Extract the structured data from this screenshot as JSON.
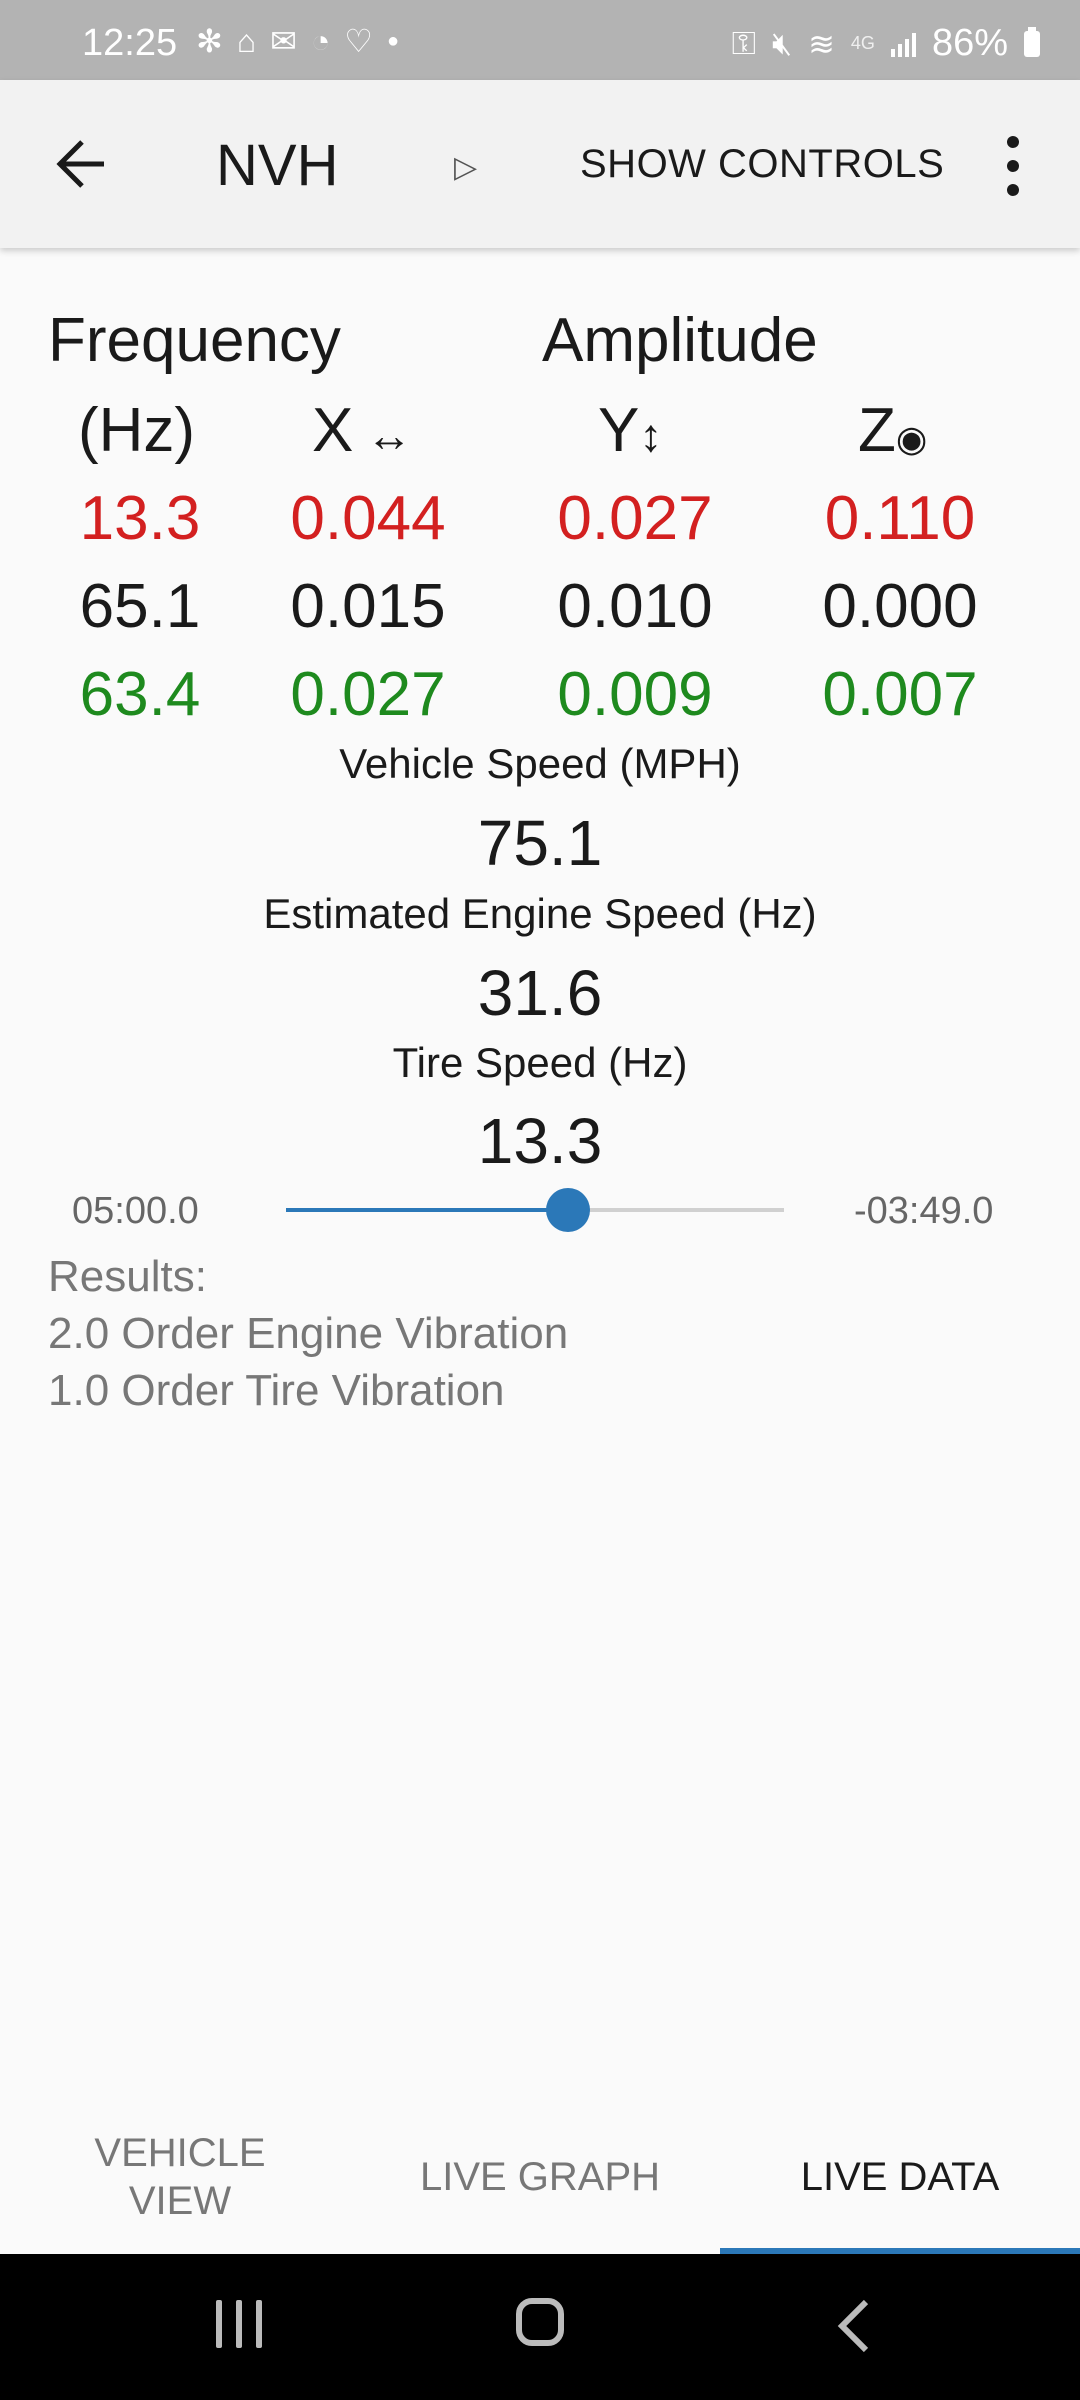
{
  "status_bar": {
    "time": "12:25",
    "battery": "86%",
    "network": "4G"
  },
  "app_bar": {
    "title": "NVH",
    "show_controls": "SHOW CONTROLS"
  },
  "table": {
    "headers": {
      "frequency": "Frequency",
      "amplitude": "Amplitude",
      "hz": "(Hz)",
      "x": "X",
      "y": "Y",
      "z": "Z"
    },
    "rows": [
      {
        "frequency": "13.3",
        "x": "0.044",
        "y": "0.027",
        "z": "0.110",
        "color": "#d32020"
      },
      {
        "frequency": "65.1",
        "x": "0.015",
        "y": "0.010",
        "z": "0.000",
        "color": "#1a1a1a"
      },
      {
        "frequency": "63.4",
        "x": "0.027",
        "y": "0.009",
        "z": "0.007",
        "color": "#1e8a1e"
      }
    ]
  },
  "vehicle_speed": {
    "label": "Vehicle Speed (MPH)",
    "value": "75.1"
  },
  "engine_speed": {
    "label": "Estimated Engine Speed (Hz)",
    "value": "31.6"
  },
  "tire_speed": {
    "label": "Tire Speed (Hz)",
    "value": "13.3"
  },
  "playback": {
    "elapsed": "05:00.0",
    "remaining": "-03:49.0",
    "position_fraction": 0.567
  },
  "results": {
    "heading": "Results:",
    "items": [
      "2.0 Order Engine Vibration",
      "1.0 Order Tire Vibration"
    ]
  },
  "tabs": [
    {
      "label": "VEHICLE VIEW",
      "active": false
    },
    {
      "label": "LIVE GRAPH",
      "active": false
    },
    {
      "label": "LIVE DATA",
      "active": true
    }
  ],
  "colors": {
    "accent": "#2b78b8",
    "row_high": "#d32020",
    "row_low": "#1e8a1e"
  }
}
